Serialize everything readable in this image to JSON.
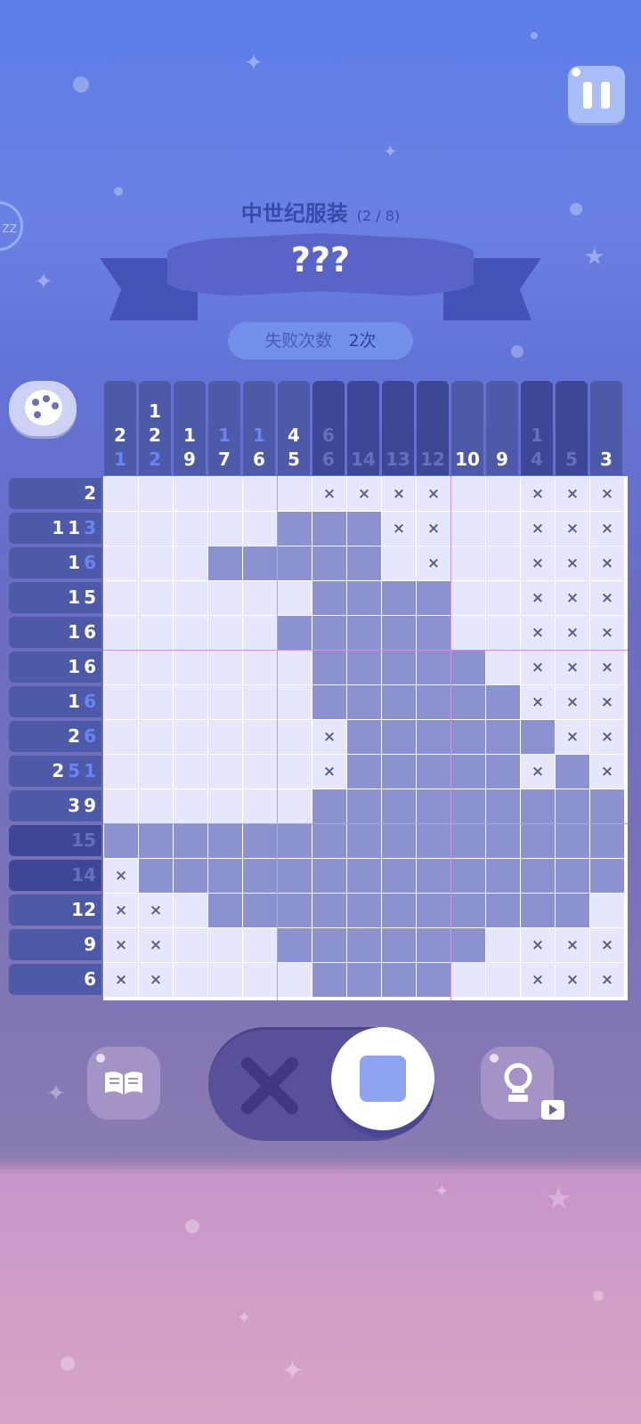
{
  "header": {
    "theme_title": "中世纪服装",
    "theme_progress": "(2 / 8)",
    "puzzle_name": "???",
    "fail_label": "失败次数",
    "fail_value": "2次",
    "sleep_label": "ZZ"
  },
  "icons": {
    "pause": "pause-icon",
    "palette": "palette-icon",
    "book": "book-icon",
    "hint": "lightbulb-icon",
    "video": "video-play-icon",
    "cross_mode": "cross-icon",
    "fill_mode": "fill-square-icon"
  },
  "colors": {
    "cell_empty": "#e6e7fd",
    "cell_filled": "#8c91cf",
    "accent_blue": "#5d7ee8",
    "done_clue_blue": "#6a84f6"
  },
  "puzzle": {
    "size": 15,
    "col_clues": [
      {
        "nums": [
          "2",
          "1"
        ],
        "highlight": [
          1
        ],
        "state": "normal"
      },
      {
        "nums": [
          "1",
          "2",
          "2"
        ],
        "highlight": [
          2
        ],
        "state": "normal"
      },
      {
        "nums": [
          "1",
          "9"
        ],
        "highlight": [],
        "state": "normal"
      },
      {
        "nums": [
          "1",
          "7"
        ],
        "highlight": [
          0
        ],
        "state": "normal"
      },
      {
        "nums": [
          "1",
          "6"
        ],
        "highlight": [
          0
        ],
        "state": "normal"
      },
      {
        "nums": [
          "4",
          "5"
        ],
        "highlight": [],
        "state": "normal"
      },
      {
        "nums": [
          "6",
          "6"
        ],
        "highlight": [],
        "state": "done"
      },
      {
        "nums": [
          "14"
        ],
        "highlight": [],
        "state": "done"
      },
      {
        "nums": [
          "13"
        ],
        "highlight": [],
        "state": "done"
      },
      {
        "nums": [
          "12"
        ],
        "highlight": [],
        "state": "done"
      },
      {
        "nums": [
          "10"
        ],
        "highlight": [],
        "state": "normal"
      },
      {
        "nums": [
          "9"
        ],
        "highlight": [],
        "state": "normal"
      },
      {
        "nums": [
          "1",
          "4"
        ],
        "highlight": [
          0,
          1
        ],
        "state": "done"
      },
      {
        "nums": [
          "5"
        ],
        "highlight": [],
        "state": "done"
      },
      {
        "nums": [
          "3"
        ],
        "highlight": [],
        "state": "normal"
      }
    ],
    "row_clues": [
      {
        "nums": [
          "2"
        ],
        "highlight": [],
        "state": "normal"
      },
      {
        "nums": [
          "1",
          "1",
          "3"
        ],
        "highlight": [
          2
        ],
        "state": "normal"
      },
      {
        "nums": [
          "1",
          "6"
        ],
        "highlight": [
          1
        ],
        "state": "normal"
      },
      {
        "nums": [
          "1",
          "5"
        ],
        "highlight": [],
        "state": "normal"
      },
      {
        "nums": [
          "1",
          "6"
        ],
        "highlight": [],
        "state": "normal"
      },
      {
        "nums": [
          "1",
          "6"
        ],
        "highlight": [],
        "state": "normal"
      },
      {
        "nums": [
          "1",
          "6"
        ],
        "highlight": [
          1
        ],
        "state": "normal"
      },
      {
        "nums": [
          "2",
          "6"
        ],
        "highlight": [
          1
        ],
        "state": "normal"
      },
      {
        "nums": [
          "2",
          "5",
          "1"
        ],
        "highlight": [
          1,
          2
        ],
        "state": "normal"
      },
      {
        "nums": [
          "3",
          "9"
        ],
        "highlight": [],
        "state": "normal"
      },
      {
        "nums": [
          "15"
        ],
        "highlight": [],
        "state": "done"
      },
      {
        "nums": [
          "14"
        ],
        "highlight": [],
        "state": "done"
      },
      {
        "nums": [
          "12"
        ],
        "highlight": [],
        "state": "normal"
      },
      {
        "nums": [
          "9"
        ],
        "highlight": [],
        "state": "normal"
      },
      {
        "nums": [
          "6"
        ],
        "highlight": [],
        "state": "normal"
      }
    ],
    "grid": [
      "......XXXX..XXX",
      ".....###XX..XXX",
      "...#####.X..XXX",
      "......####..XXX",
      ".....#####..XXX",
      "......#####.XXX",
      "......######XXX",
      "......X######XX",
      "......X#####X#X",
      "......#########",
      "###############",
      "X##############",
      "XX.###########.",
      "XX...######.XXX",
      "XX....####..XXX"
    ]
  }
}
